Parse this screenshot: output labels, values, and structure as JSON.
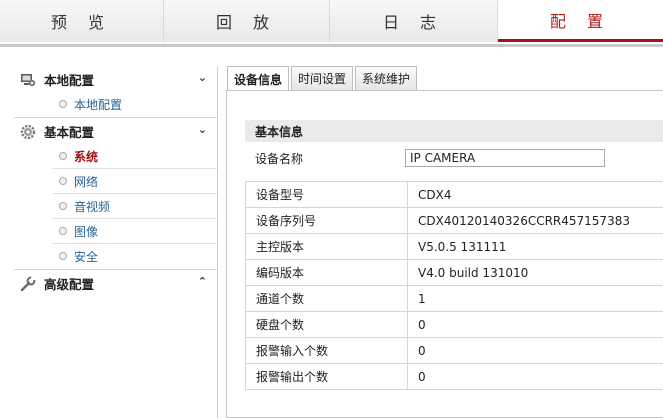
{
  "topnav": {
    "tabs": [
      {
        "label": "预 览"
      },
      {
        "label": "回 放"
      },
      {
        "label": "日 志"
      },
      {
        "label": "配 置"
      }
    ]
  },
  "sidebar": {
    "groups": [
      {
        "label": "本地配置",
        "icon": "monitor-gear-icon",
        "items": [
          {
            "label": "本地配置"
          }
        ]
      },
      {
        "label": "基本配置",
        "icon": "gear-icon",
        "items": [
          {
            "label": "系统"
          },
          {
            "label": "网络"
          },
          {
            "label": "音视频"
          },
          {
            "label": "图像"
          },
          {
            "label": "安全"
          }
        ]
      },
      {
        "label": "高级配置",
        "icon": "wrench-icon",
        "items": []
      }
    ],
    "chevron_down": "⌄",
    "chevron_up": "⌃"
  },
  "content": {
    "tabs": [
      {
        "label": "设备信息"
      },
      {
        "label": "时间设置"
      },
      {
        "label": "系统维护"
      }
    ],
    "section_title": "基本信息",
    "device_name": {
      "label": "设备名称",
      "value": "IP CAMERA"
    },
    "rows": [
      {
        "key": "设备型号",
        "value": "CDX4"
      },
      {
        "key": "设备序列号",
        "value": "CDX40120140326CCRR457157383"
      },
      {
        "key": "主控版本",
        "value": "V5.0.5 131111"
      },
      {
        "key": "编码版本",
        "value": "V4.0 build 131010"
      },
      {
        "key": "通道个数",
        "value": "1"
      },
      {
        "key": "硬盘个数",
        "value": "0"
      },
      {
        "key": "报警输入个数",
        "value": "0"
      },
      {
        "key": "报警输出个数",
        "value": "0"
      }
    ]
  },
  "colors": {
    "accent": "#a31313",
    "link": "#2a6496"
  }
}
